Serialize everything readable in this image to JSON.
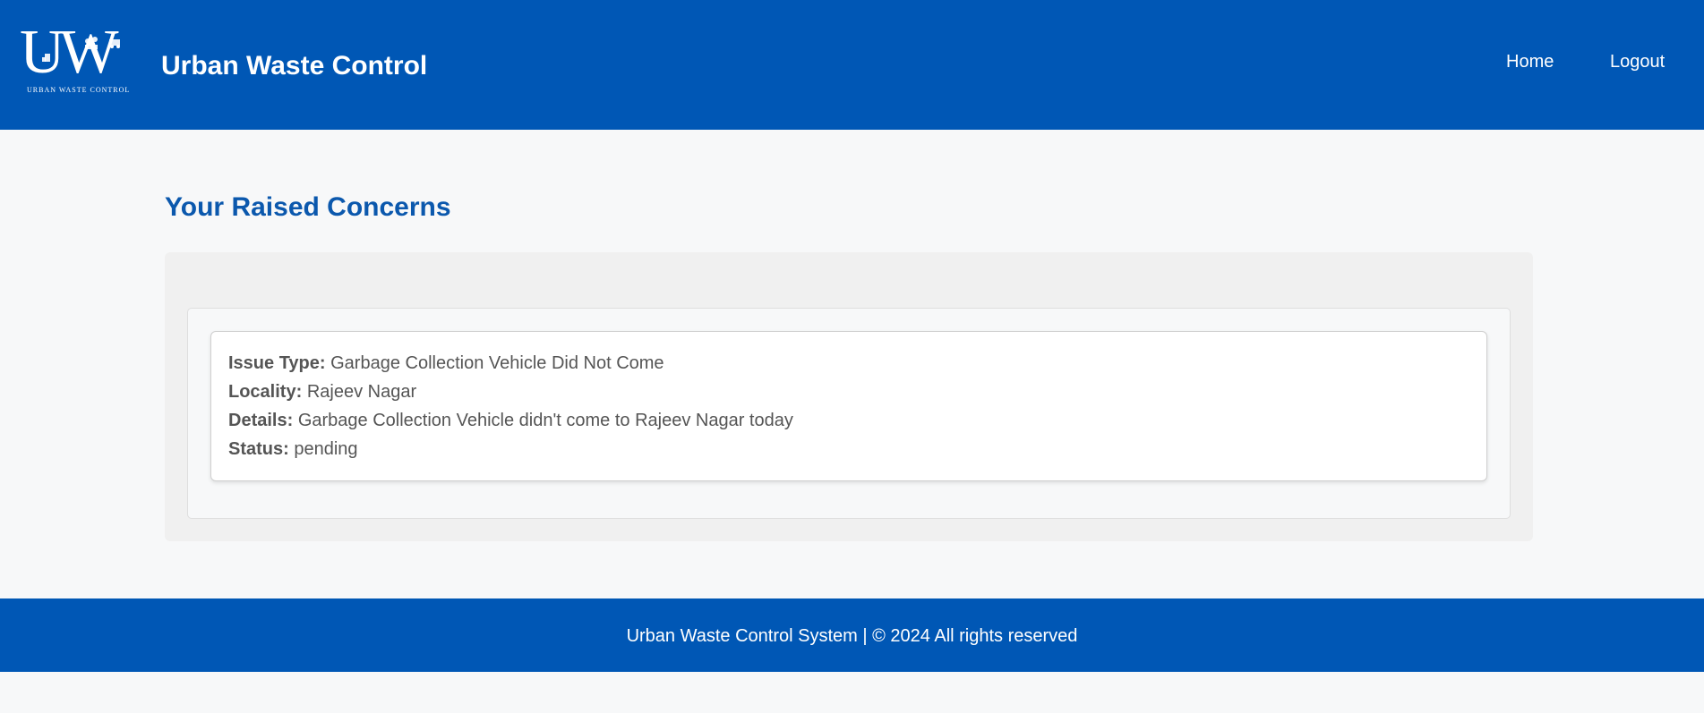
{
  "header": {
    "logo_mark": "UW",
    "logo_subtitle": "URBAN WASTE CONTROL",
    "title": "Urban Waste Control",
    "nav": {
      "home": "Home",
      "logout": "Logout"
    }
  },
  "main": {
    "heading": "Your Raised Concerns",
    "concerns": [
      {
        "issue_type_label": "Issue Type:",
        "issue_type": "Garbage Collection Vehicle Did Not Come",
        "locality_label": "Locality:",
        "locality": "Rajeev Nagar",
        "details_label": "Details:",
        "details": "Garbage Collection Vehicle didn't come to Rajeev Nagar today",
        "status_label": "Status:",
        "status": "pending"
      }
    ]
  },
  "footer": {
    "text": "Urban Waste Control System | © 2024 All rights reserved"
  },
  "colors": {
    "brand_blue": "#0057b5",
    "heading_blue": "#0b58ad",
    "page_background": "#f7f8f9"
  }
}
